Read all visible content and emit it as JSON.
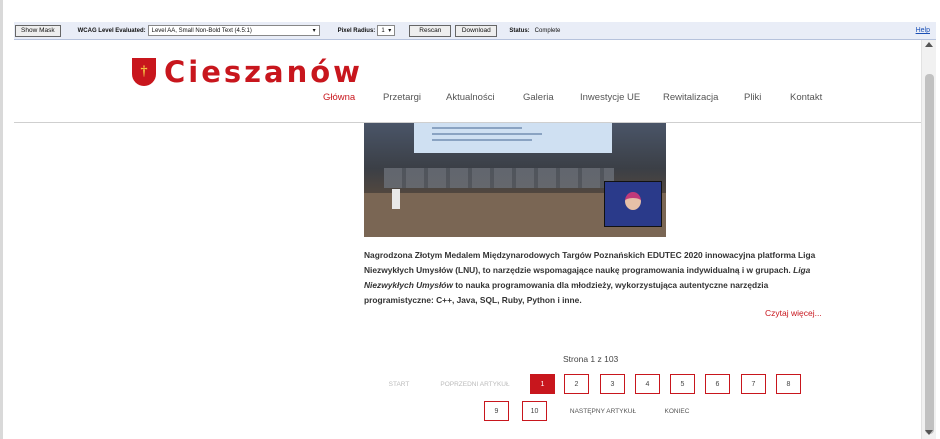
{
  "toolbar": {
    "show_mask_label": "Show Mask",
    "wcag_level_label": "WCAG Level Evaluated:",
    "wcag_level_value": "Level AA, Small Non-Bold Text (4.5:1)",
    "pixel_radius_label": "Pixel Radius:",
    "pixel_radius_value": "1",
    "rescan_label": "Rescan",
    "download_label": "Download",
    "status_label": "Status:",
    "status_value": "Complete",
    "help_label": "Help"
  },
  "header": {
    "logo_text": "Cieszanów",
    "nav": [
      {
        "label": "Główna",
        "active": true
      },
      {
        "label": "Przetargi"
      },
      {
        "label": "Aktualności"
      },
      {
        "label": "Galeria"
      },
      {
        "label": "Inwestycje UE"
      },
      {
        "label": "Rewitalizacja"
      },
      {
        "label": "Pliki"
      },
      {
        "label": "Kontakt"
      }
    ]
  },
  "article": {
    "text_1": "Nagrodzona Złotym Medalem Międzynarodowych Targów Poznańskich EDUTEC 2020 innowacyjna platforma Liga Niezwykłych Umysłów (LNU), to narzędzie wspomagające naukę programowania indywidualną i w grupach. ",
    "text_em": "Liga Niezwykłych Umysłów",
    "text_2": " to nauka programowania dla młodzieży, wykorzystująca autentyczne narzędzia programistyczne: C++, Java, SQL, Ruby, Python i inne.",
    "read_more": "Czytaj więcej..."
  },
  "pagination": {
    "page_count": "Strona 1 z 103",
    "start": "START",
    "prev": "POPRZEDNI ARTYKUŁ",
    "pages": [
      "1",
      "2",
      "3",
      "4",
      "5",
      "6",
      "7",
      "8",
      "9",
      "10"
    ],
    "current": "1",
    "next": "NASTĘPNY ARTYKUŁ",
    "end": "KONIEC"
  },
  "colors": {
    "accent": "#c8161d",
    "toolbar_bg": "#e9edf7"
  }
}
